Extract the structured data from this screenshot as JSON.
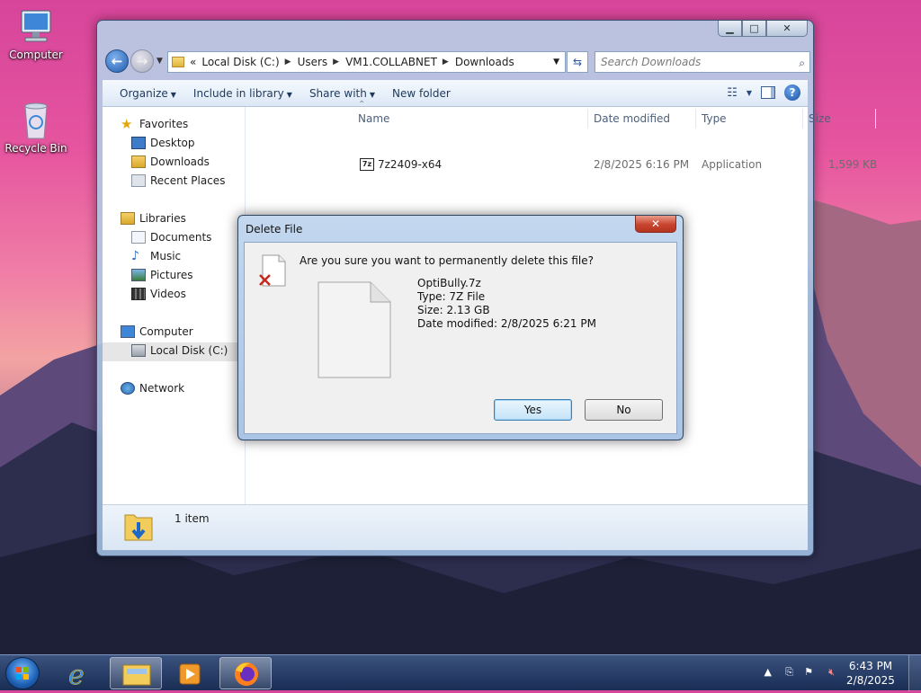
{
  "desktop": {
    "icons": [
      {
        "label": "Computer"
      },
      {
        "label": "Recycle Bin"
      }
    ]
  },
  "explorer": {
    "address": {
      "overflow": "«",
      "segments": [
        "Local Disk (C:)",
        "Users",
        "VM1.COLLABNET",
        "Downloads"
      ]
    },
    "search_placeholder": "Search Downloads",
    "toolbar": {
      "organize": "Organize",
      "include_in_library": "Include in library",
      "share_with": "Share with",
      "new_folder": "New folder"
    },
    "nav": {
      "favorites": "Favorites",
      "desktop": "Desktop",
      "downloads": "Downloads",
      "recent_places": "Recent Places",
      "libraries": "Libraries",
      "documents": "Documents",
      "music": "Music",
      "pictures": "Pictures",
      "videos": "Videos",
      "computer": "Computer",
      "local_disk": "Local Disk (C:)",
      "network": "Network"
    },
    "columns": {
      "name": "Name",
      "date_modified": "Date modified",
      "type": "Type",
      "size": "Size"
    },
    "files": [
      {
        "name": "7z2409-x64",
        "date_modified": "2/8/2025 6:16 PM",
        "type": "Application",
        "size": "1,599 KB"
      }
    ],
    "details": {
      "count": "1 item"
    }
  },
  "dialog": {
    "title": "Delete File",
    "close_glyph": "✕",
    "question": "Are you sure you want to permanently delete this file?",
    "file_name": "OptiBully.7z",
    "file_type": "Type: 7Z File",
    "file_size": "Size: 2.13 GB",
    "file_date": "Date modified: 2/8/2025 6:21 PM",
    "yes_label": "Yes",
    "no_label": "No"
  },
  "taskbar": {
    "time": "6:43 PM",
    "date": "2/8/2025"
  },
  "colors": {
    "accent": "#1f5aad",
    "dialog_close": "#c8442e",
    "taskbar": "#2a4175"
  }
}
